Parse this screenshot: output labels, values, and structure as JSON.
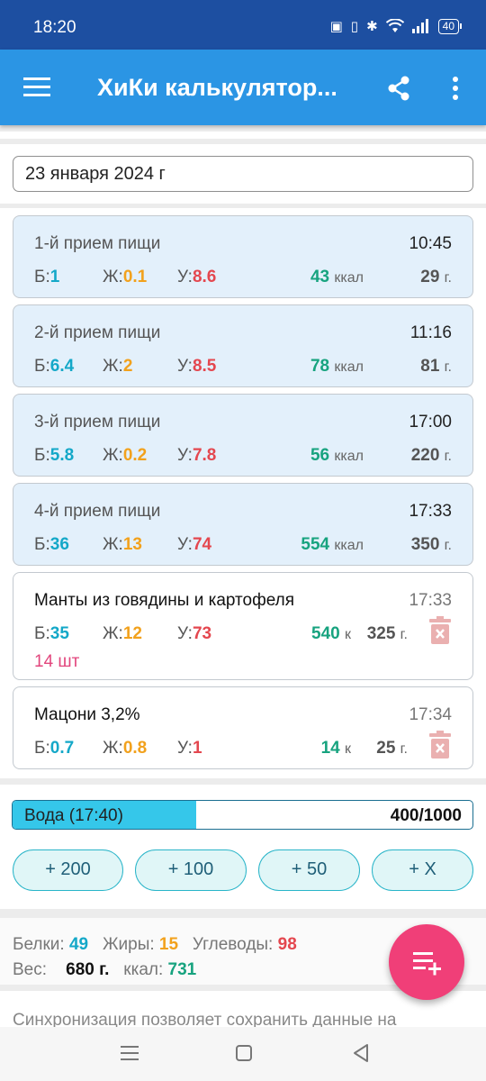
{
  "status_bar": {
    "time": "18:20",
    "battery": "40"
  },
  "app_bar": {
    "title": "ХиКи калькулятор..."
  },
  "date": "23 января 2024 г",
  "meals": [
    {
      "name": "1-й прием пищи",
      "time": "10:45",
      "p": "1",
      "f": "0.1",
      "c": "8.6",
      "kcal": "43",
      "weight": "29"
    },
    {
      "name": "2-й прием пищи",
      "time": "11:16",
      "p": "6.4",
      "f": "2",
      "c": "8.5",
      "kcal": "78",
      "weight": "81"
    },
    {
      "name": "3-й прием пищи",
      "time": "17:00",
      "p": "5.8",
      "f": "0.2",
      "c": "7.8",
      "kcal": "56",
      "weight": "220"
    },
    {
      "name": "4-й прием пищи",
      "time": "17:33",
      "p": "36",
      "f": "13",
      "c": "74",
      "kcal": "554",
      "weight": "350"
    }
  ],
  "products": [
    {
      "name": "Манты из говядины и картофеля",
      "time": "17:33",
      "p": "35",
      "f": "12",
      "c": "73",
      "kcal": "540",
      "weight": "325",
      "qty": "14 шт"
    },
    {
      "name": "Мацони 3,2%",
      "time": "17:34",
      "p": "0.7",
      "f": "0.8",
      "c": "1",
      "kcal": "14",
      "weight": "25"
    }
  ],
  "labels": {
    "protein_short": "Б:",
    "fat_short": "Ж:",
    "carbs_short": "У:",
    "kcal_unit": "ккал",
    "kcal_short": "к",
    "gram_unit": "г.",
    "protein": "Белки:",
    "fat": "Жиры:",
    "carbs": "Углеводы:",
    "weight": "Вес:",
    "kcal": "ккал:"
  },
  "water": {
    "label": "Вода (17:40)",
    "current": 400,
    "goal": 1000,
    "count_text": "400/1000",
    "buttons": [
      "+ 200",
      "+ 100",
      "+ 50",
      "+ X"
    ]
  },
  "totals": {
    "protein": "49",
    "fat": "15",
    "carbs": "98",
    "weight": "680 г.",
    "kcal": "731"
  },
  "sync_text": "Синхронизация позволяет сохранить данные на",
  "colors": {
    "status_bar": "#1d4fa1",
    "app_bar": "#2b95e4",
    "protein": "#14a8c8",
    "fat": "#f2a11c",
    "carbs": "#e4474f",
    "kcal": "#17a37f",
    "fab": "#f03f78",
    "water_fill": "#35c7ea",
    "meal_bg": "#e3f0fb"
  },
  "icons": {
    "menu": "hamburger-icon",
    "share": "share-icon",
    "more": "more-vert-icon",
    "trash": "trash-icon",
    "fab": "add-list-icon"
  }
}
